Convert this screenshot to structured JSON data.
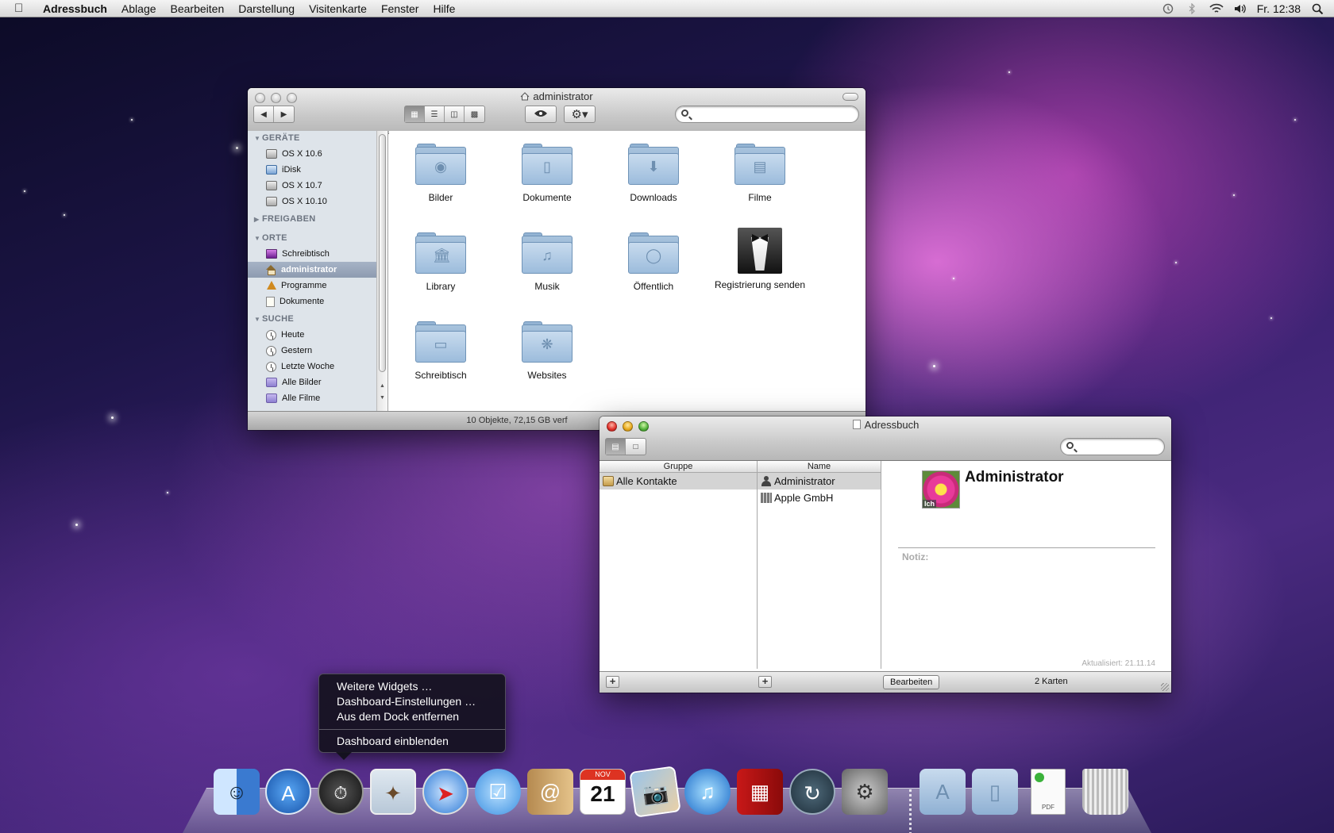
{
  "menubar": {
    "app_name": "Adressbuch",
    "items": [
      "Ablage",
      "Bearbeiten",
      "Darstellung",
      "Visitenkarte",
      "Fenster",
      "Hilfe"
    ],
    "clock": "Fr. 12:38"
  },
  "finder": {
    "title": "administrator",
    "sidebar": {
      "sections": [
        {
          "title": "GERÄTE",
          "items": [
            "OS X 10.6",
            "iDisk",
            "OS X 10.7",
            "OS X 10.10"
          ]
        },
        {
          "title": "FREIGABEN",
          "items": []
        },
        {
          "title": "ORTE",
          "items": [
            "Schreibtisch",
            "administrator",
            "Programme",
            "Dokumente"
          ]
        },
        {
          "title": "SUCHE",
          "items": [
            "Heute",
            "Gestern",
            "Letzte Woche",
            "Alle Bilder",
            "Alle Filme"
          ]
        }
      ]
    },
    "items": [
      "Bilder",
      "Dokumente",
      "Downloads",
      "Filme",
      "Library",
      "Musik",
      "Öffentlich",
      "Registrierung senden",
      "Schreibtisch",
      "Websites"
    ],
    "status": "10 Objekte, 72,15 GB verf"
  },
  "addressbook": {
    "title": "Adressbuch",
    "col_group": "Gruppe",
    "col_name": "Name",
    "groups": [
      "Alle Kontakte"
    ],
    "names": [
      "Administrator",
      "Apple GmbH"
    ],
    "card_name": "Administrator",
    "avatar_badge": "Ich",
    "note_label": "Notiz:",
    "updated": "Aktualisiert: 21.11.14",
    "edit_button": "Bearbeiten",
    "count": "2 Karten"
  },
  "context_menu": {
    "items": [
      "Weitere Widgets …",
      "Dashboard-Einstellungen …",
      "Aus dem Dock entfernen"
    ],
    "footer_item": "Dashboard einblenden"
  },
  "dock": {
    "calendar_month": "NOV",
    "calendar_day": "21",
    "pdf_label": "PDF"
  }
}
